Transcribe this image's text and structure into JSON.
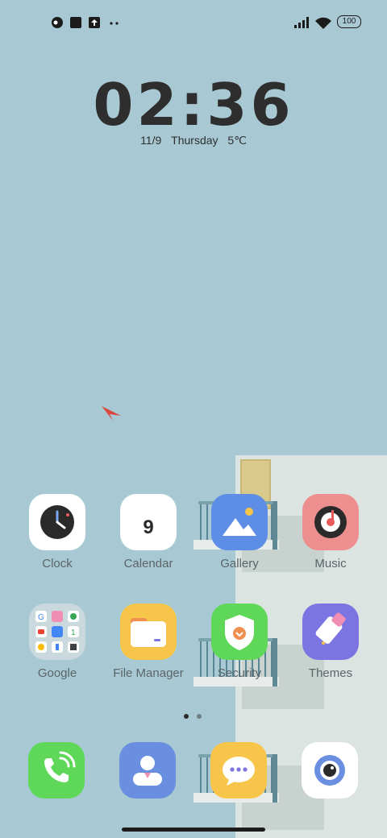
{
  "status": {
    "battery": "100",
    "colors": {
      "icon": "#1b1b1b"
    }
  },
  "lockclock": {
    "time": "02:36",
    "date": "11/9",
    "day": "Thursday",
    "temperature": "5℃"
  },
  "apps_row1": [
    {
      "label": "Clock",
      "icon": "clock-icon"
    },
    {
      "label": "Calendar",
      "icon": "calendar-icon",
      "day_number": "9"
    },
    {
      "label": "Gallery",
      "icon": "gallery-icon"
    },
    {
      "label": "Music",
      "icon": "music-icon"
    }
  ],
  "apps_row2": [
    {
      "label": "Google",
      "icon": "google-folder-icon"
    },
    {
      "label": "File Manager",
      "icon": "file-manager-icon"
    },
    {
      "label": "Security",
      "icon": "security-icon"
    },
    {
      "label": "Themes",
      "icon": "themes-icon"
    }
  ],
  "dock": [
    {
      "icon": "phone-icon"
    },
    {
      "icon": "contacts-icon"
    },
    {
      "icon": "messages-icon"
    },
    {
      "icon": "camera-icon"
    }
  ],
  "pages": {
    "count": 2,
    "active": 1
  },
  "colors": {
    "wallpaper": "#a8c9d4",
    "label": "#5b6468",
    "phone": "#5fd85a",
    "contacts": "#6a8ee0",
    "messages": "#f7c54a",
    "music": "#ee8f8f",
    "gallery": "#5e8de6",
    "security": "#5fd85a",
    "themes": "#7c74e0",
    "files": "#f7c54a"
  }
}
